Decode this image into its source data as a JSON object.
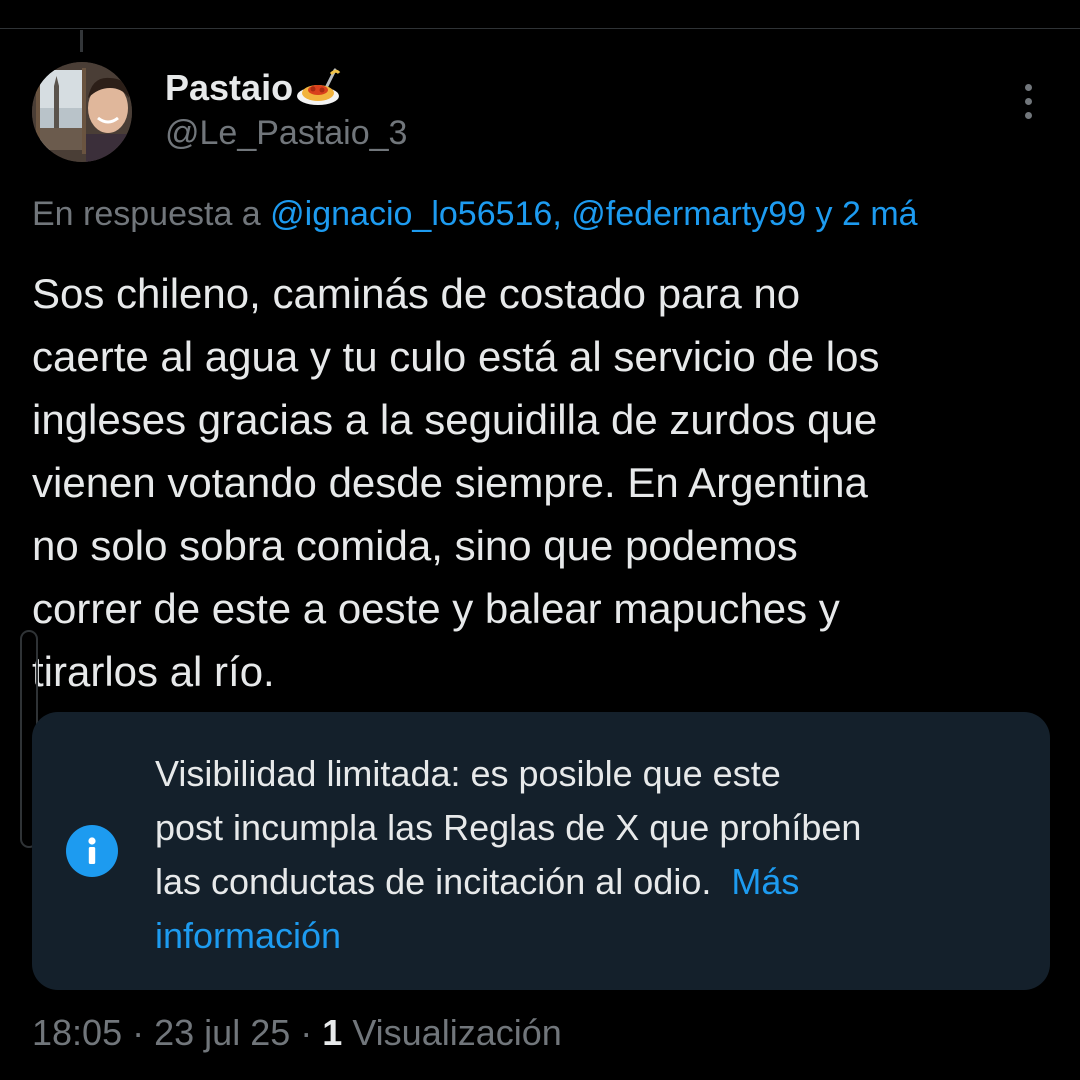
{
  "author": {
    "display_name": "Pastaio",
    "name_emoji": "spaghetti-emoji",
    "handle": "@Le_Pastaio_3"
  },
  "reply_context": {
    "prefix": "En respuesta a",
    "mentions": [
      "@ignacio_lo56516,",
      "@federmarty99"
    ],
    "others": "y 2 má"
  },
  "post": {
    "lines": [
      "Sos chileno, caminás de costado para no",
      "caerte al agua y tu culo está al servicio de los",
      "ingleses gracias a la seguidilla de zurdos que",
      "vienen votando desde siempre. En Argentina",
      "no solo sobra comida, sino que podemos",
      "correr de este a oeste y balear mapuches y",
      "tirarlos al río."
    ]
  },
  "visibility_notice": {
    "lines": [
      "Visibilidad limitada: es posible que este",
      "post incumpla las Reglas de X que prohíben",
      "las conductas de incitación al odio."
    ],
    "link_part1": "Más",
    "link_part2": "información",
    "icon": "info-icon"
  },
  "meta": {
    "time": "18:05",
    "separator": "·",
    "date": "23 jul 25",
    "views_count": "1",
    "views_label": "Visualización"
  },
  "colors": {
    "background": "#000000",
    "text": "#e7e9ea",
    "secondary": "#71767b",
    "accent": "#1d9bf0",
    "notice_bg": "#14202b"
  }
}
